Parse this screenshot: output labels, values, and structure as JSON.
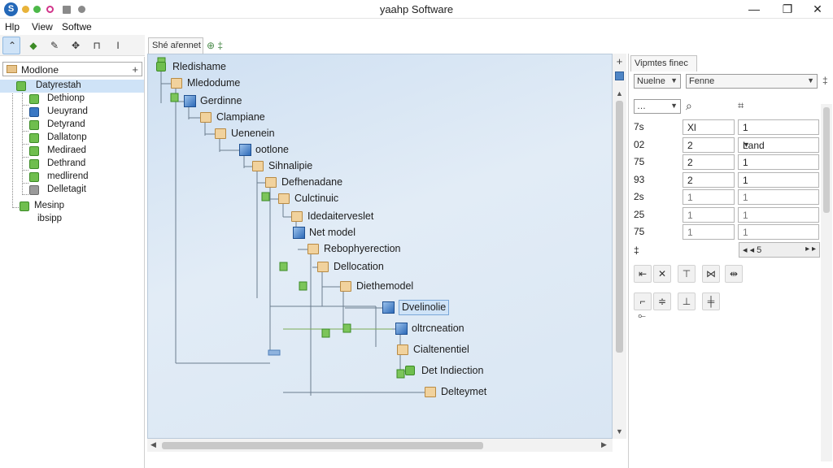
{
  "window": {
    "title": "yaahp Software",
    "minimize_glyph": "—",
    "maximize_glyph": "❐",
    "close_glyph": "✕"
  },
  "menu": [
    "Hlp",
    "View",
    "Softwe"
  ],
  "toolbar": {
    "icons": [
      "pointer-icon",
      "folder-green-icon",
      "node-add-icon",
      "connect-icon",
      "pin-icon",
      "text-cursor-icon"
    ],
    "glyphs": [
      "⌃",
      "◆",
      "✎",
      "✥",
      "⊓",
      "I"
    ]
  },
  "left_panel": {
    "dropdown_label": "Modlone",
    "dropdown_glyph": "+",
    "tree": [
      {
        "label": "Datyrestah",
        "icon": "green",
        "selected": true
      },
      {
        "label": "Dethionp",
        "icon": "green"
      },
      {
        "label": "Ueuyrand",
        "icon": "blue"
      },
      {
        "label": "Detyrand",
        "icon": "green"
      },
      {
        "label": "Dallatonp",
        "icon": "green"
      },
      {
        "label": "Mediraed",
        "icon": "green"
      },
      {
        "label": "Dethrand",
        "icon": "green"
      },
      {
        "label": "medlirend",
        "icon": "green"
      },
      {
        "label": "Delletagit",
        "icon": "gray"
      },
      {
        "label": "Mesinp",
        "icon": "green"
      },
      {
        "label": "ibsipp",
        "icon": "none"
      }
    ]
  },
  "canvas": {
    "tab_label": "Shé ařennet",
    "tab_glyph": "⊕ ‡",
    "nodes": [
      {
        "label": "Rledishame",
        "type": "green"
      },
      {
        "label": "Mledodume",
        "type": "folder"
      },
      {
        "label": "Gerdinne",
        "type": "blue"
      },
      {
        "label": "Clampiane",
        "type": "folder"
      },
      {
        "label": "Uenenein",
        "type": "folder"
      },
      {
        "label": "ootlone",
        "type": "blue"
      },
      {
        "label": "Sihnalipie",
        "type": "folder"
      },
      {
        "label": "Defhenadane",
        "type": "folder"
      },
      {
        "label": "Culctinuic",
        "type": "folder"
      },
      {
        "label": "Idedaiterveslet",
        "type": "folder"
      },
      {
        "label": "Net model",
        "type": "blue"
      },
      {
        "label": "Rebophyerection",
        "type": "folder"
      },
      {
        "label": "Dellocation",
        "type": "folder"
      },
      {
        "label": "Diethemodel",
        "type": "folder"
      },
      {
        "label": "Dvelinolie",
        "type": "blue",
        "highlighted": true
      },
      {
        "label": "oltrcneation",
        "type": "blue"
      },
      {
        "label": "Cialtenentiel",
        "type": "folder"
      },
      {
        "label": "Det Indiection",
        "type": "green"
      },
      {
        "label": "Delteymet",
        "type": "folder"
      }
    ],
    "scroll_glyphs": {
      "up": "▲",
      "down": "▼",
      "left": "◀",
      "right": "▶",
      "plus": "+"
    }
  },
  "right_panel": {
    "tab_label": "Vipmtes finec",
    "select1": "Nuelne",
    "select2": "Fenne",
    "select3": "…",
    "search_glyph": "⌕",
    "crop_glyph": "⌗",
    "caret": "▼",
    "props": [
      {
        "key": "7s",
        "v1": "Xl",
        "v2": "1",
        "dim": false
      },
      {
        "key": "02",
        "v1": "2",
        "v2": "Land",
        "dim": false,
        "dd": true
      },
      {
        "key": "75",
        "v1": "2",
        "v2": "1",
        "dim": false
      },
      {
        "key": "93",
        "v1": "2",
        "v2": "1",
        "dim": false
      },
      {
        "key": "2s",
        "v1": "1",
        "v2": "1",
        "dim": true
      },
      {
        "key": "25",
        "v1": "1",
        "v2": "1",
        "dim": true
      },
      {
        "key": "75",
        "v1": "1",
        "v2": "1",
        "dim": true
      }
    ],
    "nav_label": "‡",
    "nav_value": "◂ ◂ 5",
    "nav_right": "▸ ▸",
    "tools_row1": [
      "align-left-icon",
      "distribute-icon",
      "align-top-icon",
      "spread-icon",
      "node-split-icon"
    ],
    "tools_row1_glyphs": [
      "⇤",
      "✕",
      "⊤",
      "⋈",
      "⇹"
    ],
    "tools_row2": [
      "corner-icon",
      "align-center-icon",
      "align-bottom-icon",
      "split-center-icon"
    ],
    "tools_row2_glyphs": [
      "⌐",
      "≑",
      "⊥",
      "╪"
    ],
    "tools_row3": [
      "group-icon"
    ],
    "tools_row3_glyphs": [
      "⟜"
    ]
  }
}
